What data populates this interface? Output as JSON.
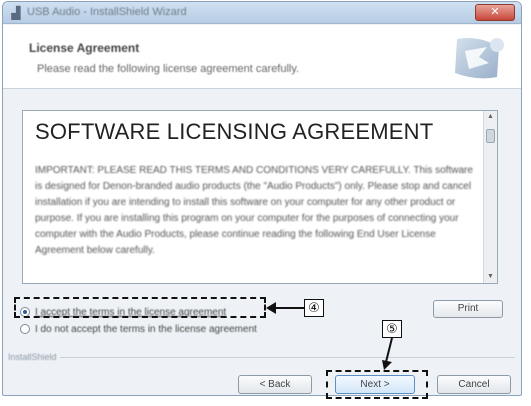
{
  "window": {
    "title": "USB Audio - InstallShield Wizard",
    "close_glyph": "✕",
    "app_icon": "installer-icon"
  },
  "header": {
    "title": "License Agreement",
    "subtitle": "Please read the following license agreement carefully."
  },
  "license": {
    "heading": "SOFTWARE LICENSING AGREEMENT",
    "body": "IMPORTANT: PLEASE READ THIS TERMS AND CONDITIONS VERY CAREFULLY. This software is designed for Denon-branded audio products (the \"Audio Products\") only. Please stop and cancel installation if you are intending to install this software on your computer for any other product or purpose. If you are installing this program on your computer for the purposes of connecting your computer with the Audio Products, please continue reading the following End User License Agreement below carefully."
  },
  "options": {
    "accept_label": "I accept the terms in the license agreement",
    "decline_label": "I do not accept the terms in the license agreement",
    "selected": "accept"
  },
  "buttons": {
    "print": "Print",
    "back": "< Back",
    "next": "Next >",
    "cancel": "Cancel"
  },
  "footer": {
    "brand": "InstallShield"
  },
  "callouts": {
    "accept_marker": "④",
    "next_marker": "⑤"
  }
}
